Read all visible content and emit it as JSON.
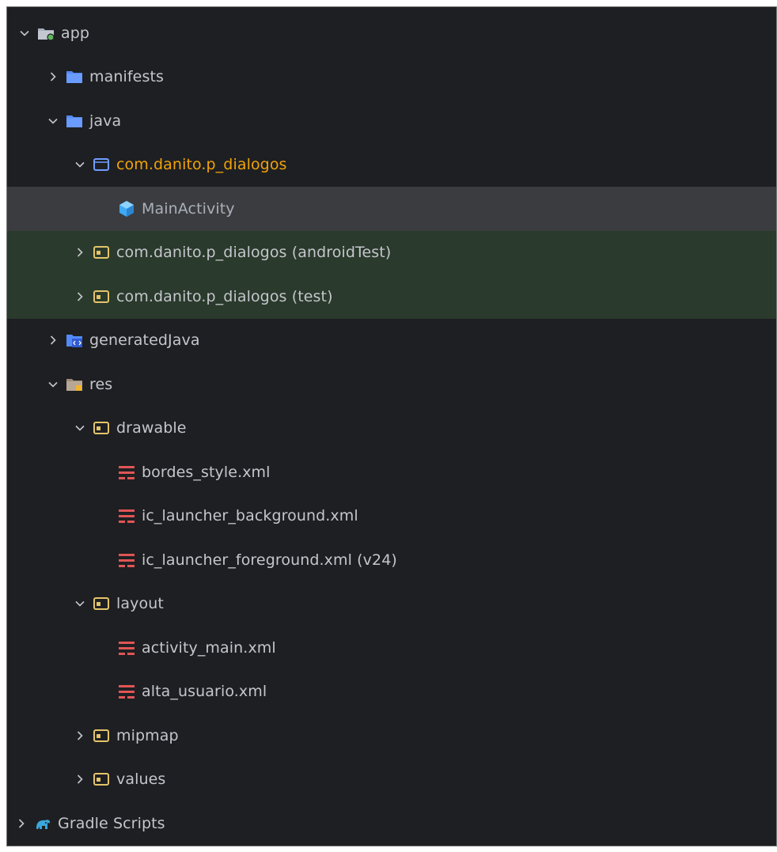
{
  "project_tree": {
    "app": {
      "label": "app"
    },
    "manifests": {
      "label": "manifests"
    },
    "java": {
      "label": "java"
    },
    "main_package": {
      "label": "com.danito.p_dialogos"
    },
    "main_activity": {
      "label": "MainActivity"
    },
    "android_test_package": {
      "label": "com.danito.p_dialogos",
      "suffix": "(androidTest)"
    },
    "test_package": {
      "label": "com.danito.p_dialogos",
      "suffix": "(test)"
    },
    "generated_java": {
      "label": "generatedJava"
    },
    "res": {
      "label": "res"
    },
    "drawable": {
      "label": "drawable"
    },
    "bordes_style": {
      "label": "bordes_style.xml"
    },
    "ic_launcher_background": {
      "label": "ic_launcher_background.xml"
    },
    "ic_launcher_foreground": {
      "label": "ic_launcher_foreground.xml",
      "suffix": "(v24)"
    },
    "layout": {
      "label": "layout"
    },
    "activity_main": {
      "label": "activity_main.xml"
    },
    "alta_usuario": {
      "label": "alta_usuario.xml"
    },
    "mipmap": {
      "label": "mipmap"
    },
    "values": {
      "label": "values"
    },
    "gradle_scripts": {
      "label": "Gradle Scripts"
    }
  },
  "colors": {
    "background": "#1e1f22",
    "selected_row": "#3b3c3f",
    "test_rows": "#2a3a2c",
    "package_highlight": "#f0a30a",
    "folder_blue": "#548af7",
    "xml_red": "#e05555"
  }
}
